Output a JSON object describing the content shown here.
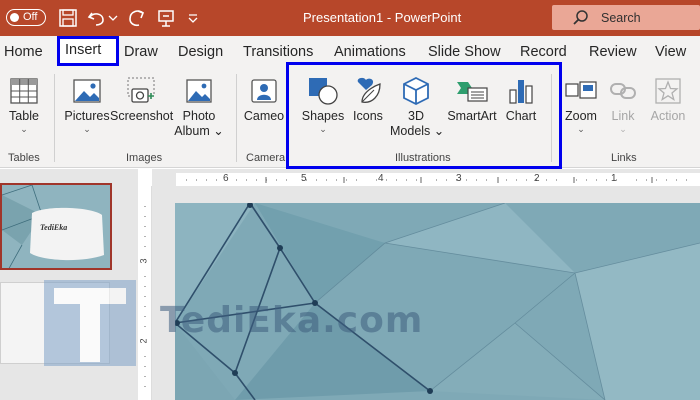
{
  "titlebar": {
    "autosave_label": "Off",
    "document_title": "Presentation1  -  PowerPoint",
    "search_label": "Search"
  },
  "tabs": [
    {
      "label": "Home"
    },
    {
      "label": "Insert"
    },
    {
      "label": "Draw"
    },
    {
      "label": "Design"
    },
    {
      "label": "Transitions"
    },
    {
      "label": "Animations"
    },
    {
      "label": "Slide Show"
    },
    {
      "label": "Record"
    },
    {
      "label": "Review"
    },
    {
      "label": "View"
    }
  ],
  "ribbon": {
    "tables": {
      "table": "Table",
      "group": "Tables"
    },
    "images": {
      "pictures": "Pictures",
      "screenshot": "Screenshot",
      "photo_album_1": "Photo",
      "photo_album_2": "Album",
      "group": "Images"
    },
    "camera": {
      "cameo": "Cameo",
      "group": "Camera"
    },
    "illustrations": {
      "shapes": "Shapes",
      "icons": "Icons",
      "models_1": "3D",
      "models_2": "Models",
      "smartart": "SmartArt",
      "chart": "Chart",
      "group": "Illustrations"
    },
    "links": {
      "zoom": "Zoom",
      "link": "Link",
      "action": "Action",
      "group": "Links"
    }
  },
  "ruler": {
    "labels": [
      "6",
      "5",
      "4",
      "3",
      "2",
      "1"
    ],
    "vlabels": [
      "3",
      "2"
    ]
  },
  "thumbnail": {
    "text": "TediEka"
  },
  "watermark": {
    "text": "TediEka.com",
    "letter": "T"
  },
  "colors": {
    "titlebar": "#b7472a",
    "highlight_box": "#0000ee",
    "ribbon_bg": "#f3f2f1",
    "slide_bg": "#7fa9b6",
    "icon_blue": "#2e6bb5",
    "icon_teal": "#2f8a8a"
  }
}
